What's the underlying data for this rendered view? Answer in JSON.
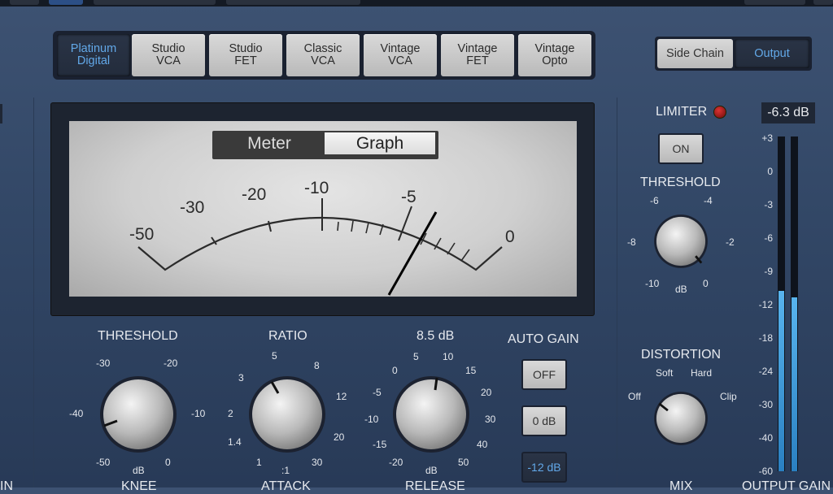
{
  "models": {
    "active_index": 0,
    "items": [
      {
        "line1": "Platinum",
        "line2": "Digital"
      },
      {
        "line1": "Studio",
        "line2": "VCA"
      },
      {
        "line1": "Studio",
        "line2": "FET"
      },
      {
        "line1": "Classic",
        "line2": "VCA"
      },
      {
        "line1": "Vintage",
        "line2": "VCA"
      },
      {
        "line1": "Vintage",
        "line2": "FET"
      },
      {
        "line1": "Vintage",
        "line2": "Opto"
      }
    ]
  },
  "sidechain": {
    "side_chain_label": "Side Chain",
    "output_label": "Output",
    "selected": "Output"
  },
  "meter": {
    "meter_tab": "Meter",
    "graph_tab": "Graph",
    "selected": "Meter",
    "scale_labels": [
      "-50",
      "-30",
      "-20",
      "-10",
      "-5",
      "0"
    ]
  },
  "threshold": {
    "title": "THRESHOLD",
    "ticks": [
      "-30",
      "-20",
      "-40",
      "-10",
      "-50",
      "0"
    ],
    "unit": "dB"
  },
  "ratio": {
    "title": "RATIO",
    "ticks": [
      "5",
      "8",
      "3",
      "12",
      "2",
      "20",
      "1.4",
      "30",
      "1"
    ],
    "unit": ":1"
  },
  "release": {
    "title": "8.5 dB",
    "ticks": [
      "0",
      "5",
      "10",
      "15",
      "-5",
      "20",
      "-10",
      "30",
      "-15",
      "40",
      "-20",
      "50"
    ],
    "unit": "dB"
  },
  "auto_gain": {
    "title": "AUTO GAIN",
    "off": "OFF",
    "zero": "0 dB",
    "minus12": "-12 dB",
    "selected": "-12 dB"
  },
  "limiter": {
    "title": "LIMITER",
    "on_label": "ON",
    "threshold_title": "THRESHOLD",
    "ticks": [
      "-6",
      "-4",
      "-8",
      "-2",
      "-10",
      "0"
    ],
    "unit": "dB"
  },
  "distortion": {
    "title": "DISTORTION",
    "soft": "Soft",
    "hard": "Hard",
    "off": "Off",
    "clip": "Clip"
  },
  "output_meter": {
    "readout": "-6.3 dB",
    "scale": [
      "+3",
      "0",
      "-3",
      "-6",
      "-9",
      "-12",
      "-18",
      "-24",
      "-30",
      "-40",
      "-60"
    ],
    "level_left": 0.54,
    "level_right": 0.52
  },
  "bottom_labels": {
    "knee": "KNEE",
    "attack": "ATTACK",
    "release": "RELEASE",
    "mix": "MIX",
    "output_gain": "OUTPUT GAIN",
    "left_cut": "IN"
  },
  "colors": {
    "accent": "#62a8e8",
    "background": "#324766",
    "led": "#c52a2a"
  }
}
